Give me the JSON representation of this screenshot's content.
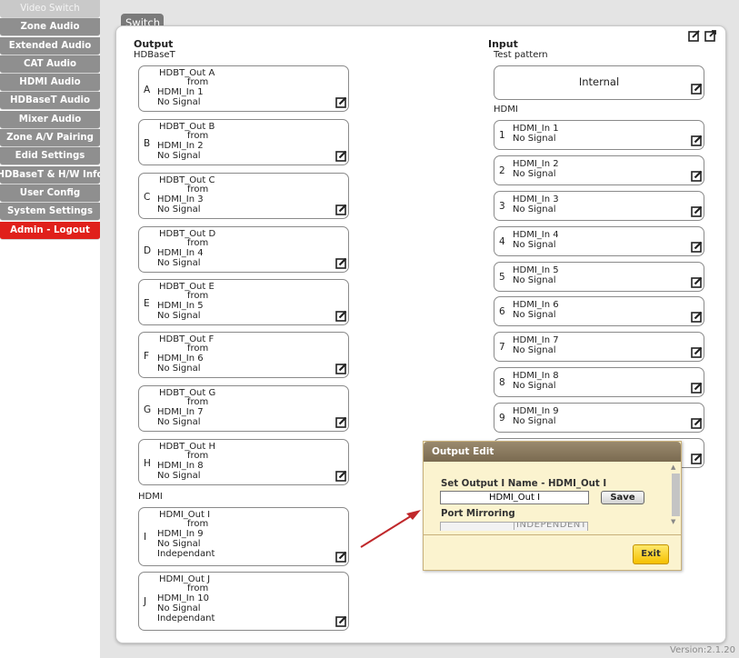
{
  "sidebar": {
    "items": [
      {
        "label": "Video Switch",
        "state": "active"
      },
      {
        "label": "Zone Audio"
      },
      {
        "label": "Extended Audio"
      },
      {
        "label": "CAT Audio"
      },
      {
        "label": "HDMI Audio"
      },
      {
        "label": "HDBaseT Audio"
      },
      {
        "label": "Mixer Audio"
      },
      {
        "label": "Zone A/V Pairing"
      },
      {
        "label": "Edid Settings"
      },
      {
        "label": "HDBaseT & H/W Info"
      },
      {
        "label": "User Config"
      },
      {
        "label": "System Settings"
      },
      {
        "label": "Admin - Logout",
        "state": "logout"
      }
    ]
  },
  "panel": {
    "tab_label": "Switch",
    "version": "Version:2.1.20"
  },
  "outputs": {
    "title": "Output",
    "hdbaset_label": "HDBaseT",
    "hdmi_label": "HDMI",
    "cards": [
      {
        "letter": "A",
        "name": "HDBT_Out A",
        "from": "from",
        "source": "HDMI_In 1",
        "signal": "No Signal"
      },
      {
        "letter": "B",
        "name": "HDBT_Out B",
        "from": "from",
        "source": "HDMI_In 2",
        "signal": "No Signal"
      },
      {
        "letter": "C",
        "name": "HDBT_Out C",
        "from": "from",
        "source": "HDMI_In 3",
        "signal": "No Signal"
      },
      {
        "letter": "D",
        "name": "HDBT_Out D",
        "from": "from",
        "source": "HDMI_In 4",
        "signal": "No Signal"
      },
      {
        "letter": "E",
        "name": "HDBT_Out E",
        "from": "from",
        "source": "HDMI_In 5",
        "signal": "No Signal"
      },
      {
        "letter": "F",
        "name": "HDBT_Out F",
        "from": "from",
        "source": "HDMI_In 6",
        "signal": "No Signal"
      },
      {
        "letter": "G",
        "name": "HDBT_Out G",
        "from": "from",
        "source": "HDMI_In 7",
        "signal": "No Signal"
      },
      {
        "letter": "H",
        "name": "HDBT_Out H",
        "from": "from",
        "source": "HDMI_In 8",
        "signal": "No Signal"
      },
      {
        "letter": "I",
        "name": "HDMI_Out I",
        "from": "from",
        "source": "HDMI_In 9",
        "signal": "No Signal",
        "mode": "Independant"
      },
      {
        "letter": "J",
        "name": "HDMI_Out J",
        "from": "from",
        "source": "HDMI_In 10",
        "signal": "No Signal",
        "mode": "Independant"
      }
    ]
  },
  "inputs": {
    "title": "Input",
    "test_pattern_label": "Test pattern",
    "internal_label": "Internal",
    "hdmi_label": "HDMI",
    "cards": [
      {
        "num": "1",
        "name": "HDMI_In 1",
        "signal": "No Signal"
      },
      {
        "num": "2",
        "name": "HDMI_In 2",
        "signal": "No Signal"
      },
      {
        "num": "3",
        "name": "HDMI_In 3",
        "signal": "No Signal"
      },
      {
        "num": "4",
        "name": "HDMI_In 4",
        "signal": "No Signal"
      },
      {
        "num": "5",
        "name": "HDMI_In 5",
        "signal": "No Signal"
      },
      {
        "num": "6",
        "name": "HDMI_In 6",
        "signal": "No Signal"
      },
      {
        "num": "7",
        "name": "HDMI_In 7",
        "signal": "No Signal"
      },
      {
        "num": "8",
        "name": "HDMI_In 8",
        "signal": "No Signal"
      },
      {
        "num": "9",
        "name": "HDMI_In 9",
        "signal": "No Signal"
      }
    ]
  },
  "popup": {
    "title": "Output Edit",
    "name_label": "Set Output I Name - HDMI_Out I",
    "name_value": "HDMI_Out I",
    "save_label": "Save",
    "mirroring_label": "Port Mirroring",
    "mirroring_value": "INDEPENDENT",
    "exit_label": "Exit"
  },
  "colors": {
    "logout_red": "#e0201b",
    "nav_gray": "#8f8f8f",
    "popup_bg": "#fbf3cf",
    "exit_yellow": "#f5c000",
    "arrow_red": "#c0282b"
  }
}
